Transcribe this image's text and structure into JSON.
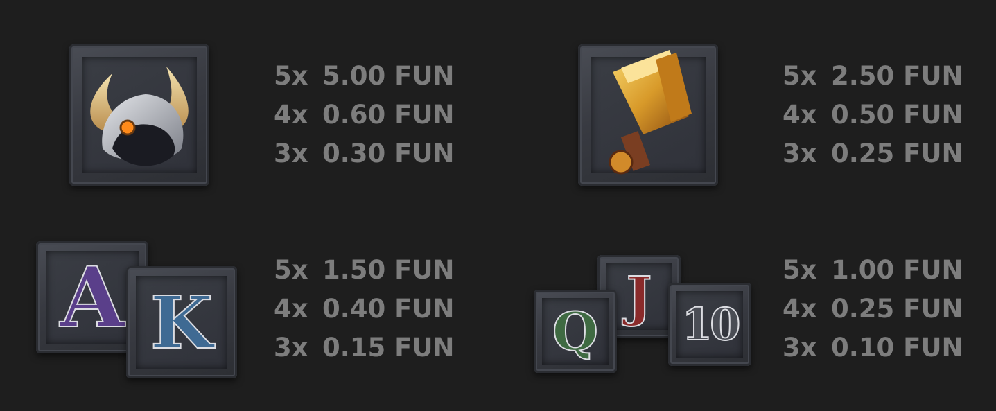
{
  "groups": [
    {
      "name": "viking-helmet",
      "rows": [
        {
          "mult": "5x",
          "amount": "5.00 FUN"
        },
        {
          "mult": "4x",
          "amount": "0.60 FUN"
        },
        {
          "mult": "3x",
          "amount": "0.30 FUN"
        }
      ]
    },
    {
      "name": "hammer",
      "rows": [
        {
          "mult": "5x",
          "amount": "2.50 FUN"
        },
        {
          "mult": "4x",
          "amount": "0.50 FUN"
        },
        {
          "mult": "3x",
          "amount": "0.25 FUN"
        }
      ]
    },
    {
      "name": "ak",
      "letters": [
        "A",
        "K"
      ],
      "rows": [
        {
          "mult": "5x",
          "amount": "1.50 FUN"
        },
        {
          "mult": "4x",
          "amount": "0.40 FUN"
        },
        {
          "mult": "3x",
          "amount": "0.15 FUN"
        }
      ]
    },
    {
      "name": "qj10",
      "letters": [
        "Q",
        "J",
        "10"
      ],
      "rows": [
        {
          "mult": "5x",
          "amount": "1.00 FUN"
        },
        {
          "mult": "4x",
          "amount": "0.25 FUN"
        },
        {
          "mult": "3x",
          "amount": "0.10 FUN"
        }
      ]
    }
  ],
  "colors": {
    "background": "#1e1e1e",
    "text": "#7d7d7d",
    "letter_A": "#5a3f8a",
    "letter_K": "#3f6a93",
    "letter_Q": "#3f6a42",
    "letter_J": "#8a2a2a",
    "letter_10": "#4a4d55"
  },
  "icons": [
    "viking-helmet-icon",
    "hammer-icon",
    "letter-a-icon",
    "letter-k-icon",
    "letter-q-icon",
    "letter-j-icon",
    "letter-10-icon"
  ]
}
